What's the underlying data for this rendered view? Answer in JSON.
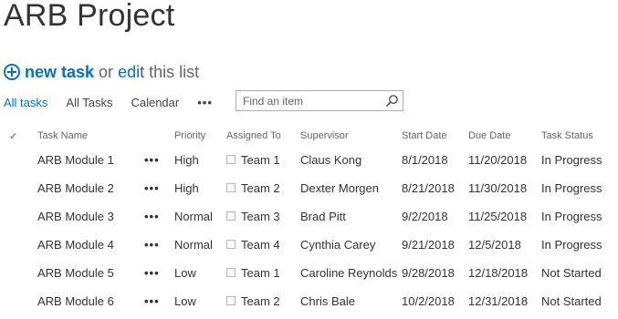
{
  "page": {
    "title": "ARB Project",
    "actions": {
      "new_label": "new task",
      "or_text": "or",
      "edit_label": "edit",
      "this_list_text": "this list"
    }
  },
  "views": {
    "tabs": [
      "All tasks",
      "All Tasks",
      "Calendar"
    ],
    "more_label": "•••"
  },
  "search": {
    "placeholder": "Find an item"
  },
  "list": {
    "columns": [
      "Task Name",
      "Priority",
      "Assigned To",
      "Supervisor",
      "Start Date",
      "Due Date",
      "Task Status"
    ],
    "check_glyph": "✓",
    "row_menu_label": "•••",
    "rows": [
      {
        "task": "ARB Module 1",
        "priority": "High",
        "assigned": "Team 1",
        "supervisor": "Claus Kong",
        "start": "8/1/2018",
        "due": "11/20/2018",
        "status": "In Progress"
      },
      {
        "task": "ARB Module 2",
        "priority": "High",
        "assigned": "Team 2",
        "supervisor": "Dexter Morgen",
        "start": "8/21/2018",
        "due": "11/30/2018",
        "status": "In Progress"
      },
      {
        "task": "ARB Module 3",
        "priority": "Normal",
        "assigned": "Team 3",
        "supervisor": "Brad Pitt",
        "start": "9/2/2018",
        "due": "11/25/2018",
        "status": "In Progress"
      },
      {
        "task": "ARB Module 4",
        "priority": "Normal",
        "assigned": "Team 4",
        "supervisor": "Cynthia Carey",
        "start": "9/21/2018",
        "due": "12/5/2018",
        "status": "In Progress"
      },
      {
        "task": "ARB Module 5",
        "priority": "Low",
        "assigned": "Team 1",
        "supervisor": "Caroline Reynolds",
        "start": "9/28/2018",
        "due": "12/18/2018",
        "status": "Not Started"
      },
      {
        "task": "ARB Module 6",
        "priority": "Low",
        "assigned": "Team 2",
        "supervisor": "Chris Bale",
        "start": "10/2/2018",
        "due": "12/31/2018",
        "status": "Not Started"
      }
    ]
  },
  "colors": {
    "accent": "#0072c6",
    "text": "#333333",
    "muted": "#666666"
  }
}
